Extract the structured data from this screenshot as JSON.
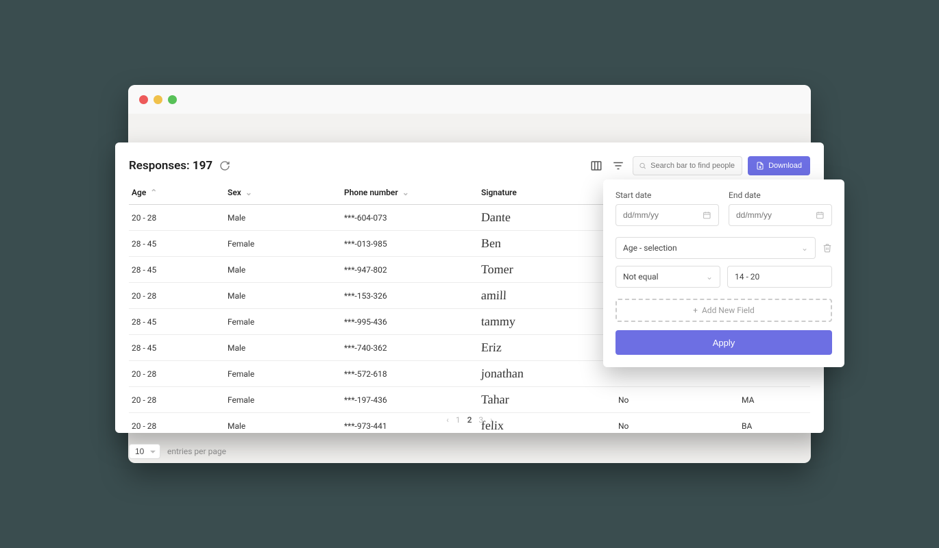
{
  "header": {
    "responses_label": "Responses:",
    "responses_count": "197",
    "search_placeholder": "Search bar to find people",
    "download_label": "Download",
    "columns_icon": "columns-icon",
    "filter_icon": "filter-icon",
    "refresh_icon": "refresh-icon"
  },
  "columns": {
    "age": "Age",
    "sex": "Sex",
    "phone": "Phone number",
    "signature": "Signature",
    "extra1": "",
    "extra2": ""
  },
  "rows": [
    {
      "age": "20 - 28",
      "sex": "Male",
      "phone": "***-604-073",
      "signature": "Dante",
      "extra1": "",
      "extra2": ""
    },
    {
      "age": "28 - 45",
      "sex": "Female",
      "phone": "***-013-985",
      "signature": "Ben",
      "extra1": "",
      "extra2": ""
    },
    {
      "age": "28 - 45",
      "sex": "Male",
      "phone": "***-947-802",
      "signature": "Tomer",
      "extra1": "",
      "extra2": ""
    },
    {
      "age": "20 - 28",
      "sex": "Male",
      "phone": "***-153-326",
      "signature": "amill",
      "extra1": "",
      "extra2": ""
    },
    {
      "age": "28 - 45",
      "sex": "Female",
      "phone": "***-995-436",
      "signature": "tammy",
      "extra1": "",
      "extra2": ""
    },
    {
      "age": "28 - 45",
      "sex": "Male",
      "phone": "***-740-362",
      "signature": "Eriz",
      "extra1": "",
      "extra2": ""
    },
    {
      "age": "20 - 28",
      "sex": "Female",
      "phone": "***-572-618",
      "signature": "jonathan",
      "extra1": "",
      "extra2": ""
    },
    {
      "age": "20 - 28",
      "sex": "Female",
      "phone": "***-197-436",
      "signature": "Tahar",
      "extra1": "No",
      "extra2": "MA"
    },
    {
      "age": "20 - 28",
      "sex": "Male",
      "phone": "***-973-441",
      "signature": "felix",
      "extra1": "No",
      "extra2": "BA"
    }
  ],
  "footer": {
    "per_page_value": "10",
    "per_page_label": "entries per page",
    "pages": {
      "p1": "1",
      "p2": "2",
      "p3": "3"
    },
    "active_page": "2"
  },
  "filter": {
    "start_date_label": "Start date",
    "end_date_label": "End date",
    "date_placeholder": "dd/mm/yy",
    "field_select": "Age - selection",
    "operator": "Not equal",
    "value": "14 - 20",
    "add_field_label": "Add New Field",
    "apply_label": "Apply"
  }
}
